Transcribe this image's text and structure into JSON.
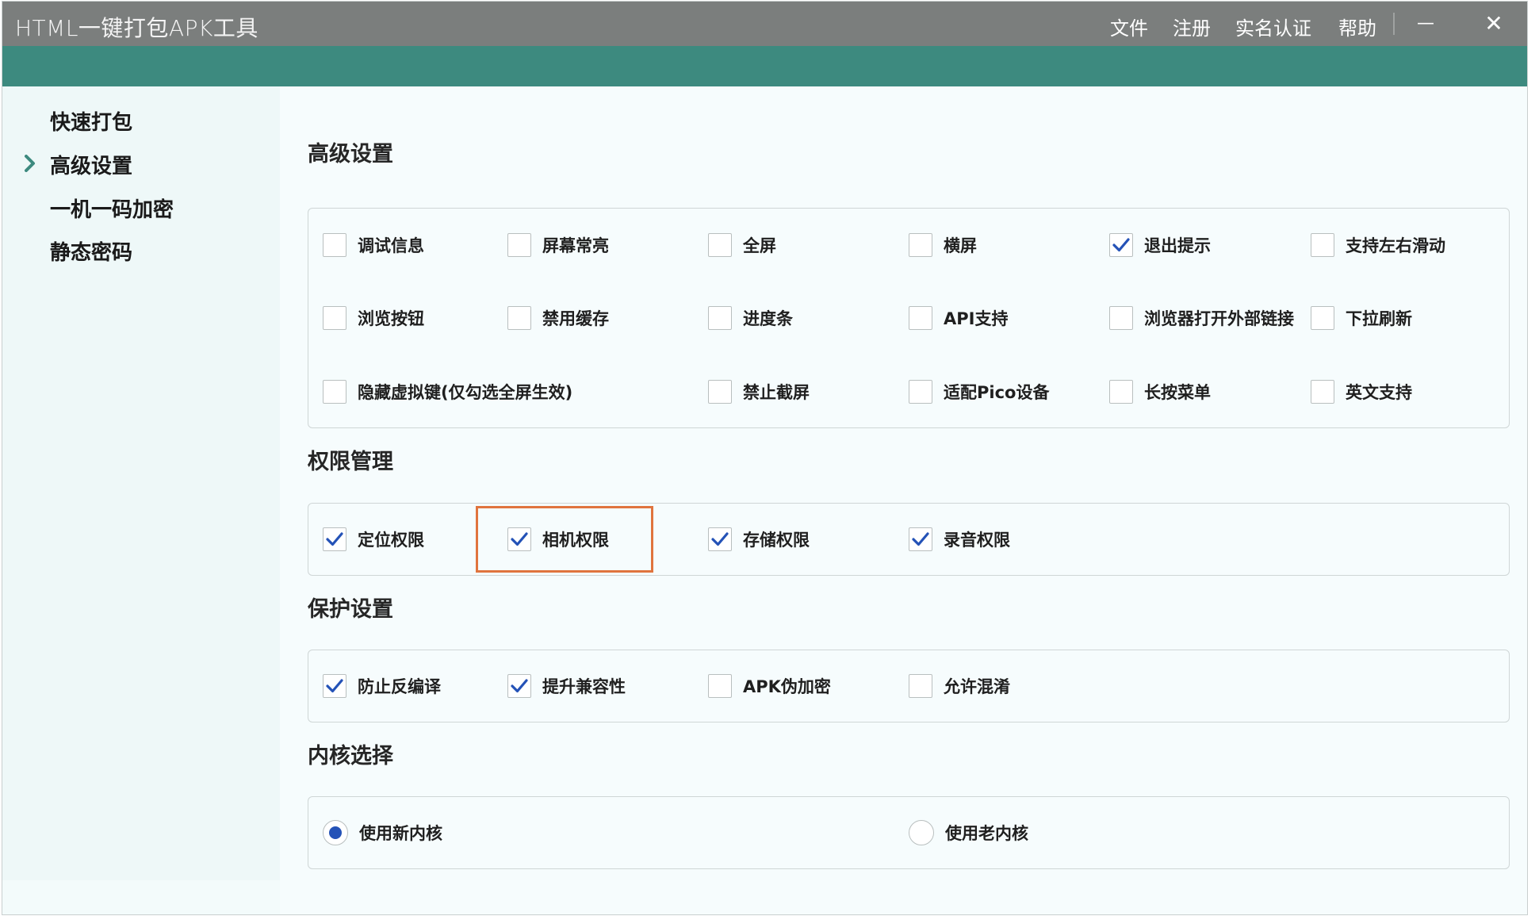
{
  "window": {
    "title": "HTML一键打包APK工具",
    "menu": [
      "文件",
      "注册",
      "实名认证",
      "帮助"
    ],
    "minimize_glyph": "—",
    "close_glyph": "✕"
  },
  "sidebar": {
    "items": [
      {
        "label": "快速打包",
        "active": false
      },
      {
        "label": "高级设置",
        "active": true
      },
      {
        "label": "一机一码加密",
        "active": false
      },
      {
        "label": "静态密码",
        "active": false
      }
    ]
  },
  "sections": {
    "advanced": {
      "title": "高级设置",
      "options": [
        {
          "label": "调试信息",
          "checked": false
        },
        {
          "label": "屏幕常亮",
          "checked": false
        },
        {
          "label": "全屏",
          "checked": false
        },
        {
          "label": "横屏",
          "checked": false
        },
        {
          "label": "退出提示",
          "checked": true
        },
        {
          "label": "支持左右滑动",
          "checked": false
        },
        {
          "label": "浏览按钮",
          "checked": false
        },
        {
          "label": "禁用缓存",
          "checked": false
        },
        {
          "label": "进度条",
          "checked": false
        },
        {
          "label": "API支持",
          "checked": false
        },
        {
          "label": "浏览器打开外部链接",
          "checked": false
        },
        {
          "label": "下拉刷新",
          "checked": false
        },
        {
          "label": "隐藏虚拟键(仅勾选全屏生效)",
          "checked": false
        },
        {
          "label": "禁止截屏",
          "checked": false
        },
        {
          "label": "适配Pico设备",
          "checked": false
        },
        {
          "label": "长按菜单",
          "checked": false
        },
        {
          "label": "英文支持",
          "checked": false
        }
      ]
    },
    "permissions": {
      "title": "权限管理",
      "options": [
        {
          "label": "定位权限",
          "checked": true
        },
        {
          "label": "相机权限",
          "checked": true
        },
        {
          "label": "存储权限",
          "checked": true
        },
        {
          "label": "录音权限",
          "checked": true
        }
      ]
    },
    "protection": {
      "title": "保护设置",
      "options": [
        {
          "label": "防止反编译",
          "checked": true
        },
        {
          "label": "提升兼容性",
          "checked": true
        },
        {
          "label": "APK伪加密",
          "checked": false
        },
        {
          "label": "允许混淆",
          "checked": false
        }
      ]
    },
    "kernel": {
      "title": "内核选择",
      "options": [
        {
          "label": "使用新内核",
          "selected": true
        },
        {
          "label": "使用老内核",
          "selected": false
        }
      ]
    }
  },
  "colors": {
    "titlebar": "#7b7e7d",
    "accent_band": "#3d8a7f",
    "check": "#2452b7",
    "chevron": "#3d8a7f",
    "highlight": "#e0743e"
  }
}
